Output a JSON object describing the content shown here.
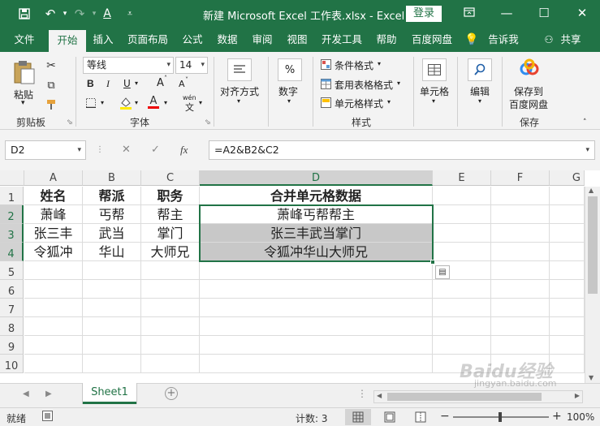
{
  "window": {
    "title": "新建 Microsoft Excel 工作表.xlsx  -  Excel",
    "login_label": "登录"
  },
  "tabs": [
    "文件",
    "开始",
    "插入",
    "页面布局",
    "公式",
    "数据",
    "审阅",
    "视图",
    "开发工具",
    "帮助",
    "百度网盘",
    "告诉我",
    "共享"
  ],
  "active_tab": "开始",
  "ribbon": {
    "clipboard": {
      "paste": "粘贴",
      "group": "剪贴板"
    },
    "font": {
      "name": "等线",
      "size": "14",
      "group": "字体",
      "bold": "B",
      "italic": "I",
      "underline": "U",
      "grow": "A",
      "shrink": "A",
      "color_a": "A",
      "wen": "wén"
    },
    "alignment": {
      "label": "对齐方式"
    },
    "number": {
      "label": "数字",
      "symbol": "%"
    },
    "styles": {
      "conditional": "条件格式",
      "table": "套用表格格式",
      "cell_style": "单元格样式",
      "group": "样式"
    },
    "cells": {
      "label": "单元格"
    },
    "editing": {
      "label": "编辑"
    },
    "save": {
      "label": "保存到\n百度网盘",
      "line1": "保存到",
      "line2": "百度网盘",
      "group": "保存"
    }
  },
  "formula_bar": {
    "name_box": "D2",
    "formula": "=A2&B2&C2",
    "fx": "fx"
  },
  "grid": {
    "columns": [
      "A",
      "B",
      "C",
      "D",
      "E",
      "F",
      "G"
    ],
    "rows": [
      "1",
      "2",
      "3",
      "4",
      "5",
      "6",
      "7",
      "8",
      "9",
      "10"
    ],
    "cells": [
      [
        "姓名",
        "帮派",
        "职务",
        "合并单元格数据"
      ],
      [
        "萧峰",
        "丐帮",
        "帮主",
        "萧峰丐帮帮主"
      ],
      [
        "张三丰",
        "武当",
        "掌门",
        "张三丰武当掌门"
      ],
      [
        "令狐冲",
        "华山",
        "大师兄",
        "令狐冲华山大师兄"
      ]
    ]
  },
  "sheet": {
    "name": "Sheet1"
  },
  "status": {
    "mode": "就绪",
    "count": "计数: 3",
    "zoom": "100%"
  },
  "watermark": {
    "brand": "Baidu经验",
    "url": "jingyan.baidu.com"
  },
  "colors": {
    "accent": "#217346",
    "ribbon_bg": "#f3f3f3",
    "shade": "#c8c8c8"
  }
}
